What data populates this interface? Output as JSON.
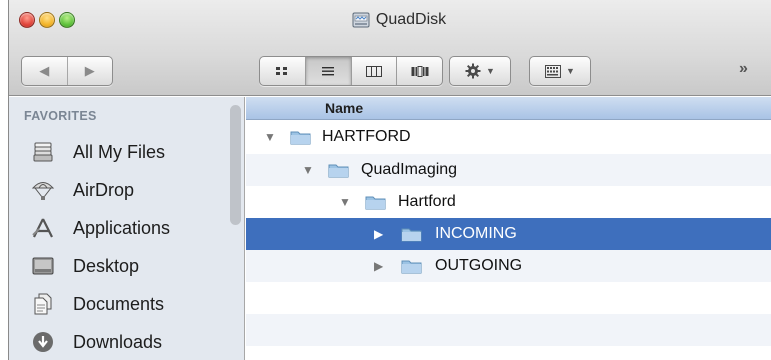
{
  "window": {
    "title": "QuadDisk",
    "title_icon": "disk-icon"
  },
  "toolbar": {
    "nav_back": "◀",
    "nav_forward": "▶",
    "views": [
      {
        "name": "icon-view",
        "active": false
      },
      {
        "name": "list-view",
        "active": true
      },
      {
        "name": "column-view",
        "active": false
      },
      {
        "name": "coverflow-view",
        "active": false
      }
    ],
    "action_icon": "gear-icon",
    "arrange_icon": "arrange-icon",
    "caret": "▼",
    "overflow": "»"
  },
  "sidebar": {
    "section_title": "FAVORITES",
    "items": [
      {
        "label": "All My Files",
        "icon": "all-files-icon"
      },
      {
        "label": "AirDrop",
        "icon": "airdrop-icon"
      },
      {
        "label": "Applications",
        "icon": "applications-icon"
      },
      {
        "label": "Desktop",
        "icon": "desktop-icon"
      },
      {
        "label": "Documents",
        "icon": "documents-icon"
      },
      {
        "label": "Downloads",
        "icon": "downloads-icon"
      }
    ]
  },
  "list": {
    "column_header": "Name",
    "rows": [
      {
        "name": "HARTFORD",
        "expanded": true,
        "depth": 0,
        "selected": false
      },
      {
        "name": "QuadImaging",
        "expanded": true,
        "depth": 1,
        "selected": false
      },
      {
        "name": "Hartford",
        "expanded": true,
        "depth": 2,
        "selected": false
      },
      {
        "name": "INCOMING",
        "expanded": false,
        "depth": 3,
        "selected": true
      },
      {
        "name": "OUTGOING",
        "expanded": false,
        "depth": 3,
        "selected": false
      }
    ],
    "triangle_expanded": "▼",
    "triangle_collapsed": "▶"
  },
  "colors": {
    "selection": "#3e6fbd",
    "sidebar_bg": "#e3e8ef",
    "header_bg": "#a9c3e5",
    "folder": "#9cc3e4"
  }
}
